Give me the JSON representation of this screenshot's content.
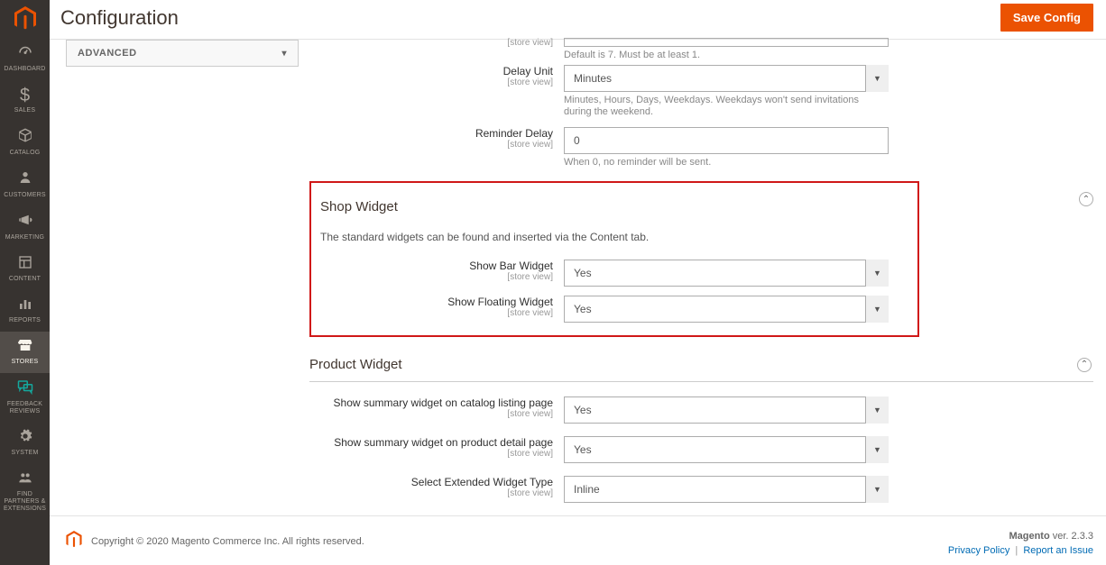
{
  "header": {
    "page_title": "Configuration",
    "save_button": "Save Config"
  },
  "sidebar": {
    "items": [
      {
        "label": "DASHBOARD"
      },
      {
        "label": "SALES"
      },
      {
        "label": "CATALOG"
      },
      {
        "label": "CUSTOMERS"
      },
      {
        "label": "MARKETING"
      },
      {
        "label": "CONTENT"
      },
      {
        "label": "REPORTS"
      },
      {
        "label": "STORES"
      },
      {
        "label": "FEEDBACK REVIEWS"
      },
      {
        "label": "SYSTEM"
      },
      {
        "label": "FIND PARTNERS & EXTENSIONS"
      }
    ]
  },
  "config_nav": {
    "section_label": "ADVANCED"
  },
  "fields": {
    "store_view_scope": "[store view]",
    "delay_default": {
      "help": "Default is 7. Must be at least 1."
    },
    "delay_unit": {
      "label": "Delay Unit",
      "value": "Minutes",
      "help": "Minutes, Hours, Days, Weekdays. Weekdays won't send invitations during the weekend."
    },
    "reminder_delay": {
      "label": "Reminder Delay",
      "value": "0",
      "help": "When 0, no reminder will be sent."
    }
  },
  "shop_widget": {
    "title": "Shop Widget",
    "description": "The standard widgets can be found and inserted via the Content tab.",
    "show_bar": {
      "label": "Show Bar Widget",
      "value": "Yes"
    },
    "show_floating": {
      "label": "Show Floating Widget",
      "value": "Yes"
    }
  },
  "product_widget": {
    "title": "Product Widget",
    "summary_listing": {
      "label": "Show summary widget on catalog listing page",
      "value": "Yes"
    },
    "summary_detail": {
      "label": "Show summary widget on product detail page",
      "value": "Yes"
    },
    "extended_type": {
      "label": "Select Extended Widget Type",
      "value": "Inline"
    }
  },
  "footer": {
    "copyright": "Copyright © 2020 Magento Commerce Inc. All rights reserved.",
    "product": "Magento",
    "version": " ver. 2.3.3",
    "privacy": "Privacy Policy",
    "report": "Report an Issue"
  }
}
